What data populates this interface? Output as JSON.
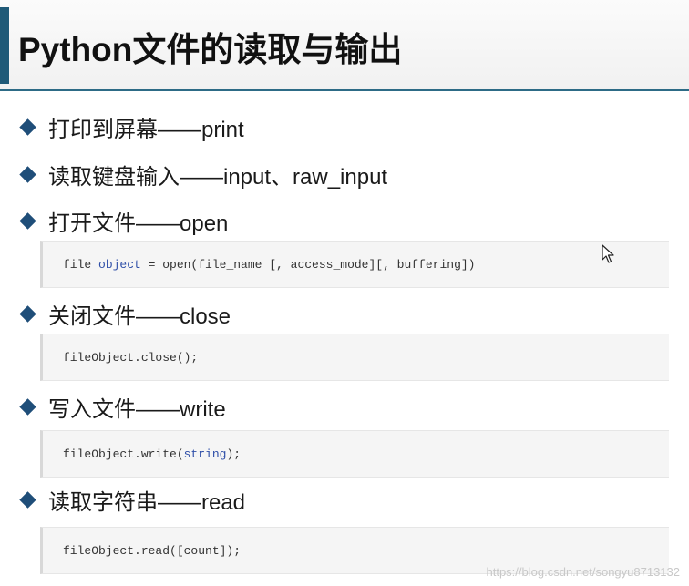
{
  "slide": {
    "title": "Python文件的读取与输出"
  },
  "bullets": [
    {
      "label": "打印到屏幕——print"
    },
    {
      "label": "读取键盘输入——input、raw_input"
    },
    {
      "label": "打开文件——open"
    },
    {
      "label": "关闭文件——close"
    },
    {
      "label": "写入文件——write"
    },
    {
      "label": "读取字符串——read"
    }
  ],
  "code": {
    "open": {
      "pre": "file ",
      "kw": "object",
      "post": " = open(file_name [, access_mode][, buffering])"
    },
    "close": {
      "text": "fileObject.close();"
    },
    "write": {
      "pre": "fileObject.write(",
      "kw": "string",
      "post": ");"
    },
    "read": {
      "text": "fileObject.read([count]);"
    }
  },
  "watermark": "https://blog.csdn.net/songyu8713132",
  "colors": {
    "accent": "#1f5a78",
    "bullet": "#1f4e79",
    "keyword": "#2f4fa8"
  }
}
